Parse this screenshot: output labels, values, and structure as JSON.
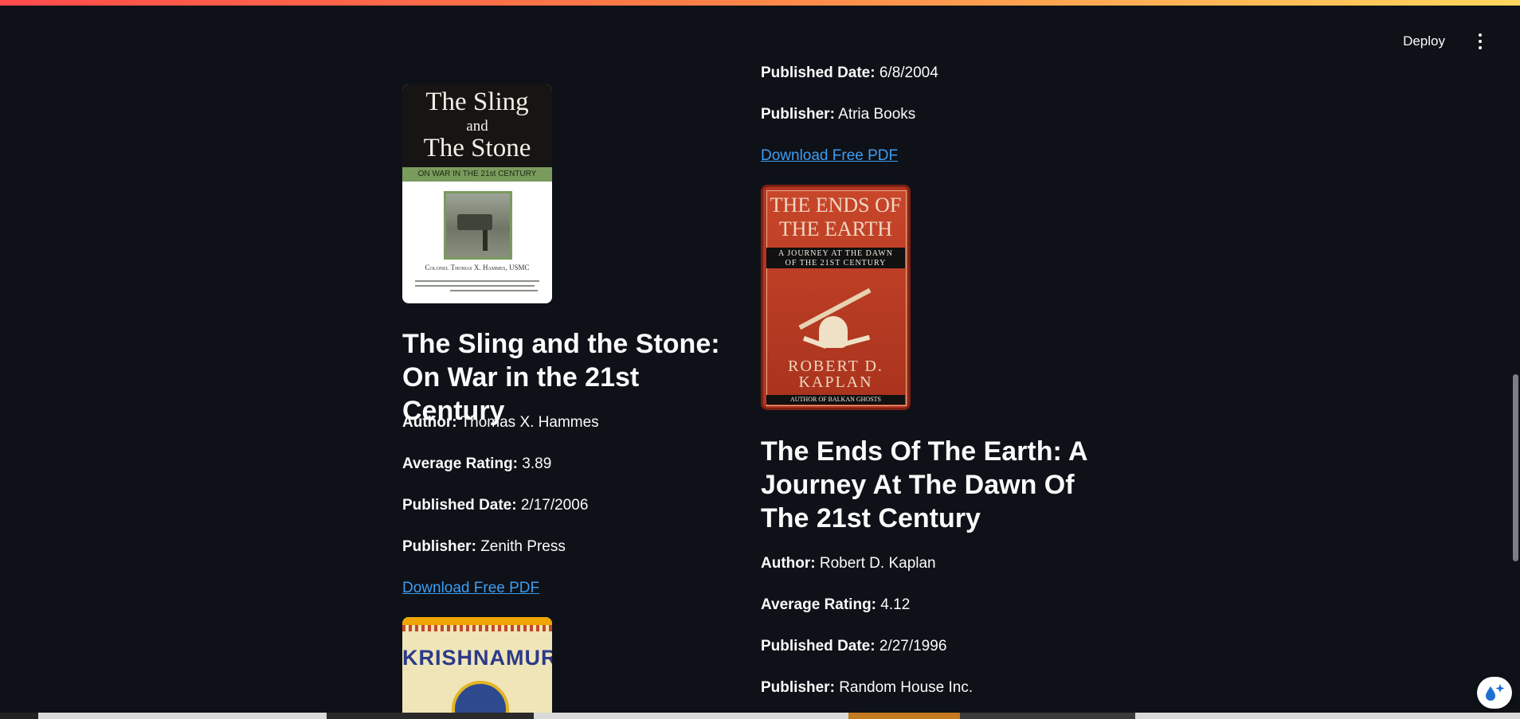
{
  "header": {
    "deploy_label": "Deploy"
  },
  "books": [
    {
      "cover": {
        "title_line1": "The Sling",
        "title_line2": "and",
        "title_line3": "The Stone",
        "subtitle": "ON WAR IN THE 21st CENTURY",
        "author_line": "Colonel Thomas X. Hammes, USMC"
      },
      "title": "The Sling and the Stone: On War in the 21st Century",
      "author_label": "Author:",
      "author": "Thomas X. Hammes",
      "rating_label": "Average Rating:",
      "rating": "3.89",
      "date_label": "Published Date:",
      "date": "2/17/2006",
      "publisher_label": "Publisher:",
      "publisher": "Zenith Press",
      "download_label": "Download Free PDF"
    },
    {
      "cover": {
        "title_line1": "KRISHNAMURTI"
      }
    }
  ],
  "right_column": {
    "prev_book": {
      "date_label": "Published Date:",
      "date": "6/8/2004",
      "publisher_label": "Publisher:",
      "publisher": "Atria Books",
      "download_label": "Download Free PDF"
    },
    "book": {
      "cover": {
        "title_line1": "THE ENDS OF",
        "title_line2": "THE EARTH",
        "subtitle_line1": "A JOURNEY AT THE DAWN",
        "subtitle_line2": "OF THE 21ST CENTURY",
        "author_line1": "ROBERT D.",
        "author_line2": "KAPLAN",
        "tagline": "AUTHOR OF BALKAN GHOSTS"
      },
      "title": "The Ends Of The Earth: A Journey At The Dawn Of The 21st Century",
      "author_label": "Author:",
      "author": "Robert D. Kaplan",
      "rating_label": "Average Rating:",
      "rating": "4.12",
      "date_label": "Published Date:",
      "date": "2/27/1996",
      "publisher_label": "Publisher:",
      "publisher": "Random House Inc."
    }
  },
  "colors": {
    "background": "#0e1117",
    "link": "#3d9df3",
    "text": "#fafafa"
  }
}
